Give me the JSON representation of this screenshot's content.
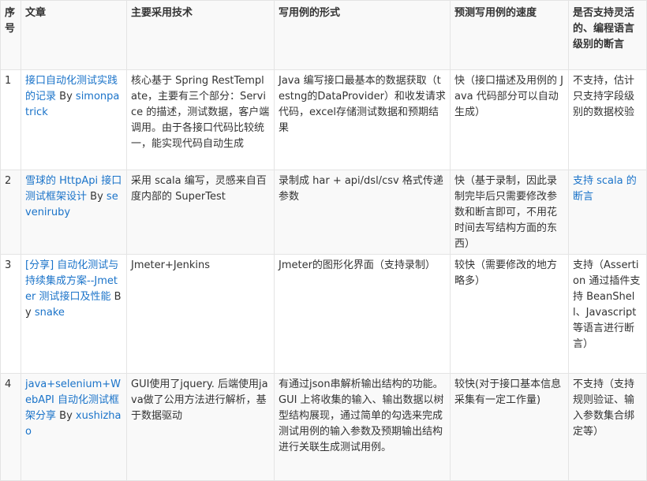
{
  "table": {
    "headers": [
      "序号",
      "文章",
      "主要采用技术",
      "写用例的形式",
      "预测写用例的速度",
      "是否支持灵活的、编程语言级别的断言"
    ],
    "rows": [
      {
        "index": "1",
        "article_title": "接口自动化测试实践的记录",
        "by_label": "By",
        "author": "simonpatrick",
        "technology": "核心基于 Spring RestTemplate，主要有三个部分：Service 的描述，测试数据，客户端调用。由于各接口代码比较统一，能实现代码自动生成",
        "case_form": "Java 编写接口最基本的数据获取（testng的DataProvider）和收发请求代码，excel存储测试数据和预期结果",
        "speed": "快（接口描述及用例的 Java 代码部分可以自动生成）",
        "assertion": "不支持，估计只支持字段级别的数据校验",
        "assertion_is_link": false
      },
      {
        "index": "2",
        "article_title": "雪球的 HttpApi 接口测试框架设计",
        "by_label": "By",
        "author": "seveniruby",
        "technology": "采用 scala 编写，灵感来自百度内部的 SuperTest",
        "case_form": "录制成 har + api/dsl/csv 格式传递参数",
        "speed": "快（基于录制，因此录制完毕后只需要修改参数和断言即可，不用花时间去写结构方面的东西）",
        "assertion": "支持 scala 的断言",
        "assertion_is_link": true
      },
      {
        "index": "3",
        "article_title": "[分享] 自动化测试与持续集成方案--Jmeter 测试接口及性能",
        "by_label": "By",
        "author": "snake",
        "technology": "Jmeter+Jenkins",
        "case_form": "Jmeter的图形化界面（支持录制）",
        "speed": "较快（需要修改的地方略多）",
        "assertion": "支持（Assertion 通过插件支持 BeanShell、Javascript 等语言进行断言）",
        "assertion_is_link": false
      },
      {
        "index": "4",
        "article_title": "java+selenium+WebAPI 自动化测试框架分享",
        "by_label": "By",
        "author": "xushizhao",
        "technology": "GUI使用了jquery. 后端使用java做了公用方法进行解析，基于数据驱动",
        "case_form": "有通过json串解析输出结构的功能。GUI 上将收集的输入、输出数据以树型结构展现，通过简单的勾选来完成测试用例的输入参数及预期输出结构进行关联生成测试用例。",
        "speed": "较快(对于接口基本信息采集有一定工作量)",
        "assertion": "不支持（支持规则验证、输入参数集合绑定等）",
        "assertion_is_link": false
      }
    ]
  }
}
